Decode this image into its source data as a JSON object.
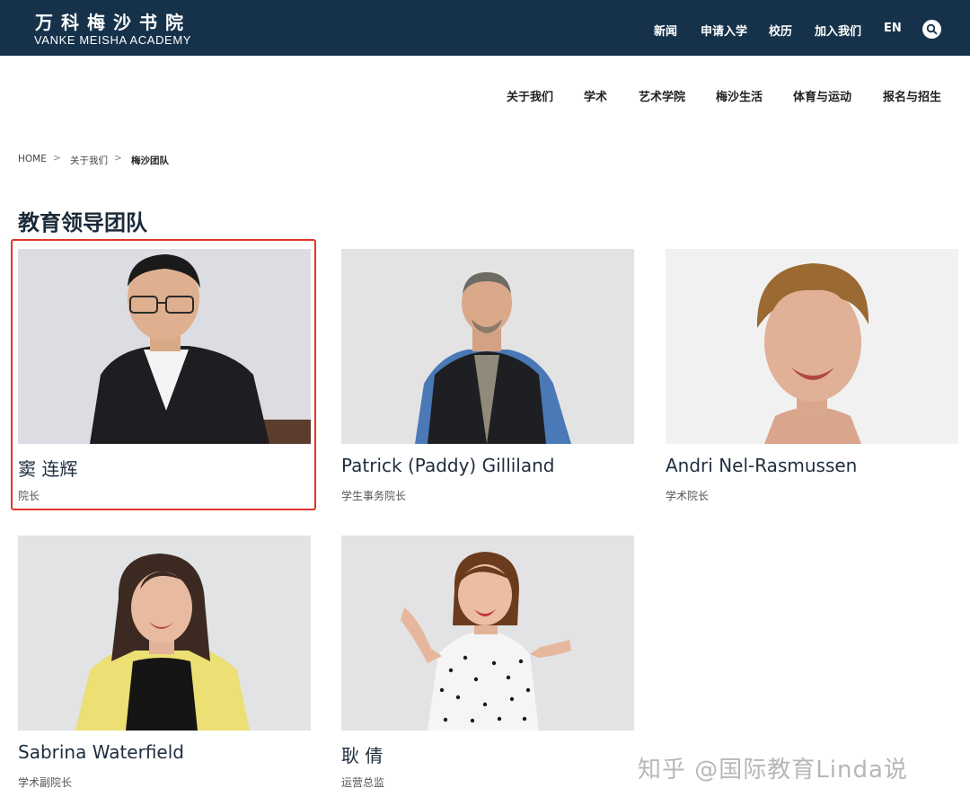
{
  "header": {
    "logo_cn": "万科梅沙书院",
    "logo_en": "VANKE MEISHA ACADEMY",
    "top_nav": [
      "新闻",
      "申请入学",
      "校历",
      "加入我们",
      "EN"
    ]
  },
  "main_nav": [
    "关于我们",
    "学术",
    "艺术学院",
    "梅沙生活",
    "体育与运动",
    "报名与招生"
  ],
  "breadcrumb": {
    "home": "HOME",
    "sep": ">",
    "level1": "关于我们",
    "current": "梅沙团队"
  },
  "section_title": "教育领导团队",
  "people": [
    {
      "name": "窦 连辉",
      "role": "院长",
      "selected": true
    },
    {
      "name": "Patrick (Paddy) Gilliland",
      "role": "学生事务院长"
    },
    {
      "name": "Andri Nel-Rasmussen",
      "role": "学术院长"
    },
    {
      "name": "Sabrina Waterfield",
      "role": "学术副院长"
    },
    {
      "name": "耿 倩",
      "role": "运营总监"
    }
  ],
  "watermark": "知乎 @国际教育Linda说",
  "colors": {
    "header_bg": "#16324a",
    "highlight": "#e2352c"
  }
}
